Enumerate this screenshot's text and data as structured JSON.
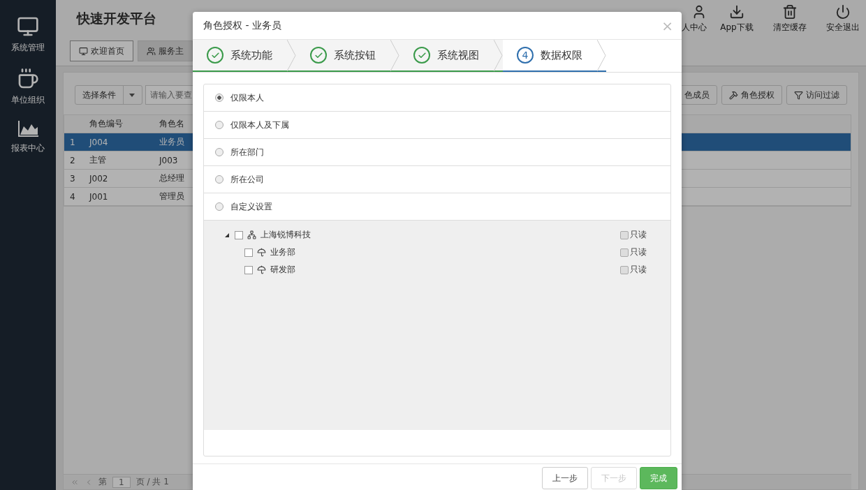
{
  "sidebar": {
    "items": [
      {
        "label": "系统管理"
      },
      {
        "label": "单位组织"
      },
      {
        "label": "报表中心"
      }
    ]
  },
  "header": {
    "title": "快速开发平台",
    "actions": [
      {
        "label": "人中心"
      },
      {
        "label": "App下载"
      },
      {
        "label": "清空缓存"
      },
      {
        "label": "安全退出"
      }
    ]
  },
  "tabs": [
    {
      "label": "欢迎首页",
      "selected": true
    },
    {
      "label": "服务主",
      "selected": false
    }
  ],
  "toolbar": {
    "condition": "选择条件",
    "search_placeholder": "请输入要查",
    "buttons": [
      {
        "label": "色成员"
      },
      {
        "label": "角色授权"
      },
      {
        "label": "访问过滤"
      }
    ]
  },
  "table": {
    "columns": [
      "角色编号",
      "角色名"
    ],
    "rows": [
      {
        "index": "1",
        "cells": [
          "J004",
          "业务员"
        ],
        "selected": true
      },
      {
        "index": "2",
        "cells": [
          "主管",
          "J003"
        ],
        "selected": false
      },
      {
        "index": "3",
        "cells": [
          "J002",
          "总经理"
        ],
        "selected": false
      },
      {
        "index": "4",
        "cells": [
          "J001",
          "管理员"
        ],
        "selected": false
      }
    ]
  },
  "pagination": {
    "prefix": "第",
    "page": "1",
    "suffix": "页 / 共 1"
  },
  "dialog": {
    "title": "角色授权 - 业务员",
    "close": "×",
    "steps": [
      {
        "label": "系统功能",
        "done": true,
        "selected": false
      },
      {
        "label": "系统按钮",
        "done": true,
        "selected": false
      },
      {
        "label": "系统视图",
        "done": true,
        "selected": false
      },
      {
        "number": "4",
        "label": "数据权限",
        "done": false,
        "selected": true
      }
    ],
    "options": [
      {
        "label": "仅限本人",
        "selected": true
      },
      {
        "label": "仅限本人及下属",
        "selected": false
      },
      {
        "label": "所在部门",
        "selected": false
      },
      {
        "label": "所在公司",
        "selected": false
      },
      {
        "label": "自定义设置",
        "selected": false
      }
    ],
    "tree": [
      {
        "label": "上海锐博科技",
        "checked": false,
        "expanded": true,
        "readonly_label": "只读",
        "readonly": false,
        "children": [
          {
            "label": "业务部",
            "checked": false,
            "readonly_label": "只读",
            "readonly": false
          },
          {
            "label": "研发部",
            "checked": false,
            "readonly_label": "只读",
            "readonly": false
          }
        ]
      }
    ],
    "buttons": [
      {
        "kind": "default",
        "label": "上一步",
        "disabled": false
      },
      {
        "kind": "default",
        "label": "下一步",
        "disabled": true
      },
      {
        "kind": "primary",
        "label": "完成",
        "disabled": false
      }
    ]
  }
}
